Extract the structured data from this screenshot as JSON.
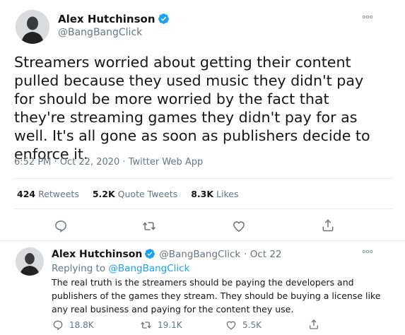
{
  "colors": {
    "verified": "#1da1f2",
    "link": "#1da1f2",
    "secondary_text": "#657786",
    "divider": "#e6ecf0"
  },
  "main_tweet": {
    "author_name": "Alex Hutchinson",
    "author_handle": "@BangBangClick",
    "more_icon": "more-dots-icon",
    "text": "Streamers worried about getting their content pulled because they used music they didn't pay for should be more worried by the fact that they're streaming games they didn't pay for as well. It's all gone as soon as publishers decide to enforce it.",
    "timestamp": "6:52 PM · Oct 22, 2020 · Twitter Web App",
    "stats": {
      "retweets_count": "424",
      "retweets_label": "Retweets",
      "quote_count": "5.2K",
      "quote_label": "Quote Tweets",
      "likes_count": "8.3K",
      "likes_label": "Likes"
    },
    "actions": [
      "reply-icon",
      "retweet-icon",
      "like-icon",
      "share-icon"
    ]
  },
  "reply_tweet": {
    "author_name": "Alex Hutchinson",
    "author_handle": "@BangBangClick",
    "date": "· Oct 22",
    "replying_prefix": "Replying to",
    "replying_to": "@BangBangClick",
    "text": "The real truth is the streamers should be paying the developers and publishers of the games they stream. They should be buying a license like any real business and paying for the content they use.",
    "replies_count": "18.8K",
    "retweets_count": "19.1K",
    "likes_count": "5.5K"
  }
}
